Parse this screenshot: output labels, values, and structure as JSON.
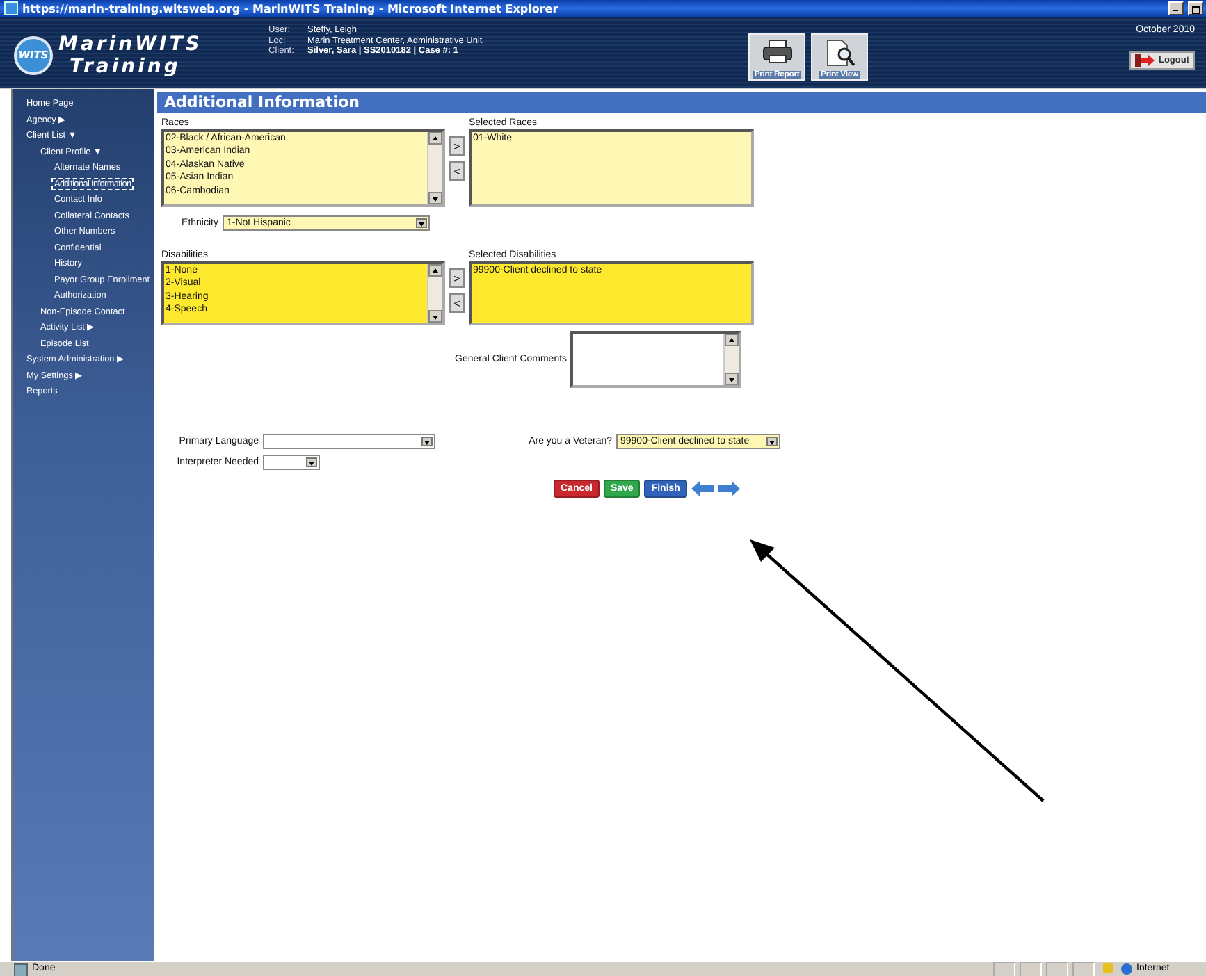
{
  "window": {
    "title": "https://marin-training.witsweb.org - MarinWITS Training - Microsoft Internet Explorer"
  },
  "header": {
    "logo_text": "WITS",
    "app_name": "MarinWITS",
    "app_subtitle": "Training",
    "info": [
      {
        "label": "User:",
        "value": "Steffy, Leigh",
        "bold": false
      },
      {
        "label": "Loc:",
        "value": "Marin Treatment Center, Administrative Unit",
        "bold": false
      },
      {
        "label": "Client:",
        "value": "Silver, Sara | SS2010182 | Case #: 1",
        "bold": true
      }
    ],
    "tools": [
      {
        "kind": "printer",
        "label": "Print Report"
      },
      {
        "kind": "view",
        "label": "Print View"
      }
    ],
    "date": "October 2010",
    "logout": "Logout"
  },
  "sidebar": {
    "items": [
      {
        "label": "Home Page",
        "selected": false
      },
      {
        "label": "Agency ▶",
        "selected": false
      },
      {
        "label": "Client List ▼",
        "selected": false,
        "children": [
          {
            "label": "Client Profile ▼",
            "selected": false,
            "children": [
              {
                "label": "Alternate Names",
                "selected": false
              },
              {
                "label": "Additional Information",
                "selected": true
              },
              {
                "label": "Contact Info",
                "selected": false
              },
              {
                "label": "Collateral Contacts",
                "selected": false
              },
              {
                "label": "Other Numbers",
                "selected": false
              },
              {
                "label": "Confidential",
                "selected": false
              },
              {
                "label": "History",
                "selected": false
              },
              {
                "label": "Payor Group Enrollment",
                "selected": false
              },
              {
                "label": "Authorization",
                "selected": false
              }
            ]
          },
          {
            "label": "Non-Episode Contact",
            "selected": false
          },
          {
            "label": "Activity List ▶",
            "selected": false
          },
          {
            "label": "Episode List",
            "selected": false
          }
        ]
      },
      {
        "label": "System Administration ▶",
        "selected": false
      },
      {
        "label": "My Settings ▶",
        "selected": false
      },
      {
        "label": "Reports",
        "selected": false
      }
    ]
  },
  "page": {
    "title": "Additional Information",
    "races": {
      "label": "Races",
      "color": "#fff8b4",
      "options": [
        "02-Black / African-American",
        "03-American Indian",
        "04-Alaskan Native",
        "05-Asian Indian",
        "06-Cambodian"
      ],
      "add_button": ">",
      "remove_button": "<",
      "selected_label": "Selected Races",
      "selected_options": [
        "01-White"
      ]
    },
    "ethnicity": {
      "label": "Ethnicity",
      "value": "1-Not Hispanic",
      "color": "#fff8b4"
    },
    "disabilities": {
      "label": "Disabilities",
      "color": "#ffe92e",
      "options": [
        "1-None",
        "2-Visual",
        "3-Hearing",
        "4-Speech"
      ],
      "add_button": ">",
      "remove_button": "<",
      "selected_label": "Selected Disabilities",
      "selected_options": [
        "99900-Client declined to state"
      ]
    },
    "comments": {
      "label": "General Client Comments"
    },
    "primary_language": {
      "label": "Primary Language",
      "color": "#ffffff"
    },
    "veteran": {
      "label": "Are you a Veteran?",
      "value": "99900-Client declined to state",
      "color": "#fff8b4"
    },
    "interpreter_needed": {
      "label": "Interpreter Needed",
      "color": "#ffffff"
    },
    "actions": [
      {
        "kind": "cancel",
        "label": "Cancel"
      },
      {
        "kind": "save",
        "label": "Save"
      },
      {
        "kind": "finish",
        "label": "Finish"
      },
      {
        "kind": "back"
      },
      {
        "kind": "forward"
      }
    ]
  },
  "annotations": [
    {
      "kind": "arrow"
    }
  ],
  "status_bar": {
    "text": "Done",
    "zone": "Internet"
  }
}
